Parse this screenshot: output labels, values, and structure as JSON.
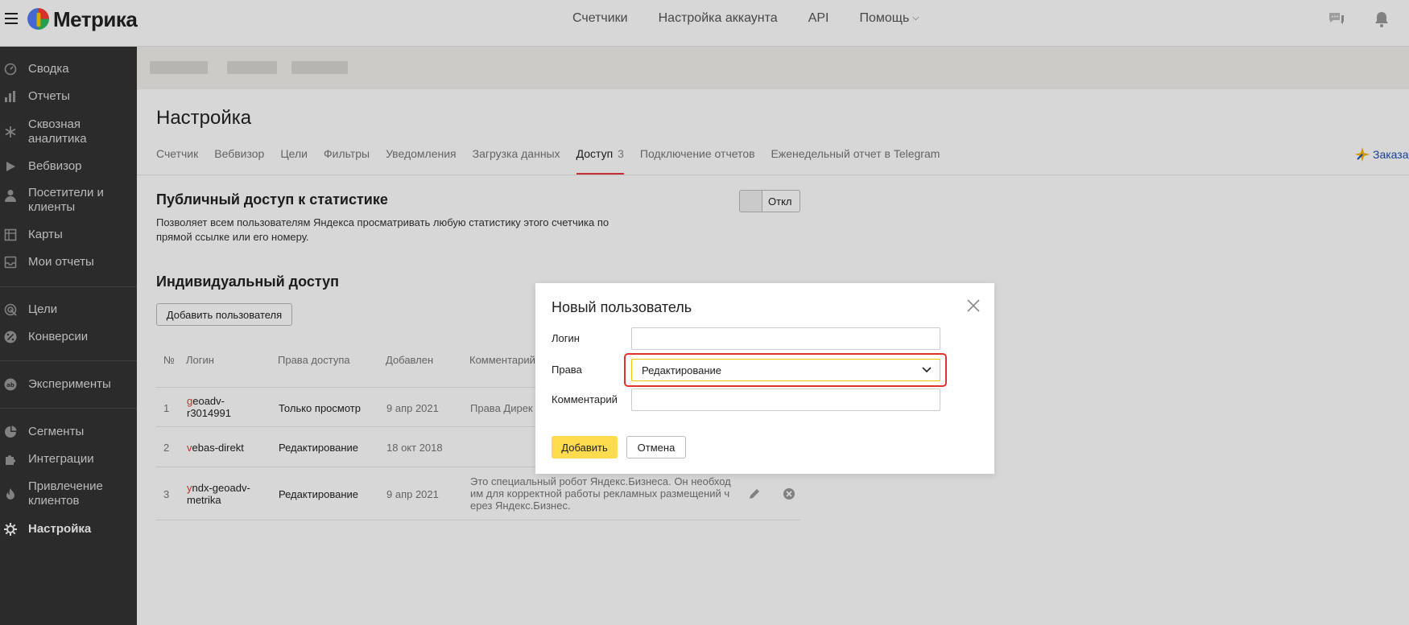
{
  "header": {
    "logo_text": "Метрика",
    "nav": [
      "Счетчики",
      "Настройка аккаунта",
      "API",
      "Помощь"
    ]
  },
  "sidebar": {
    "items": [
      {
        "label": "Сводка",
        "icon": "dashboard-icon"
      },
      {
        "label": "Отчеты",
        "icon": "bar-chart-icon"
      },
      {
        "label": "Сквозная аналитика",
        "icon": "snowflake-icon"
      },
      {
        "label": "Вебвизор",
        "icon": "play-icon"
      },
      {
        "label": "Посетители и клиенты",
        "icon": "person-icon"
      },
      {
        "label": "Карты",
        "icon": "map-icon"
      },
      {
        "label": "Мои отчеты",
        "icon": "inbox-icon"
      },
      {
        "label": "Цели",
        "icon": "target-icon"
      },
      {
        "label": "Конверсии",
        "icon": "percent-icon"
      },
      {
        "label": "Эксперименты",
        "icon": "ab-icon"
      },
      {
        "label": "Сегменты",
        "icon": "pie-icon"
      },
      {
        "label": "Интеграции",
        "icon": "puzzle-icon"
      },
      {
        "label": "Привлечение клиентов",
        "icon": "flame-icon"
      },
      {
        "label": "Настройка",
        "icon": "gear-icon",
        "active": true
      }
    ]
  },
  "page": {
    "title": "Настройка",
    "tabs": [
      "Счетчик",
      "Вебвизор",
      "Цели",
      "Фильтры",
      "Уведомления",
      "Загрузка данных",
      "Доступ",
      "Подключение отчетов",
      "Еженедельный отчет в Telegram"
    ],
    "active_tab": "Доступ",
    "access_count": "3",
    "order_link": "Заказа"
  },
  "public_access": {
    "title": "Публичный доступ к статистике",
    "description": "Позволяет всем пользователям Яндекса просматривать любую статистику этого счетчика по прямой ссылке или его номеру.",
    "toggle_label": "Откл"
  },
  "individual_access": {
    "title": "Индивидуальный доступ",
    "add_button": "Добавить пользователя",
    "columns": [
      "№",
      "Логин",
      "Права доступа",
      "Добавлен",
      "Комментарий"
    ],
    "rows": [
      {
        "num": "1",
        "login_first": "g",
        "login_rest_line1": "eoadv-",
        "login_line2": "r3014991",
        "rights": "Только просмотр",
        "added": "9 апр 2021",
        "comment": "Права Дирек"
      },
      {
        "num": "2",
        "login_first": "v",
        "login_rest_line1": "ebas-direkt",
        "login_line2": "",
        "rights": "Редактирование",
        "added": "18 окт 2018",
        "comment": ""
      },
      {
        "num": "3",
        "login_first": "y",
        "login_rest_line1": "ndx-geoadv-",
        "login_line2": "metrika",
        "rights": "Редактирование",
        "added": "9 апр 2021",
        "comment_lines": [
          "Это специальный робот Яндекс.Бизнеса. Он необход",
          "им для корректной работы рекламных размещений ч",
          "ерез Яндекс.Бизнес."
        ]
      }
    ]
  },
  "modal": {
    "title": "Новый пользователь",
    "login_label": "Логин",
    "login_value": "",
    "rights_label": "Права",
    "rights_value": "Редактирование",
    "comment_label": "Комментарий",
    "comment_value": "",
    "add_button": "Добавить",
    "cancel_button": "Отмена"
  },
  "colors": {
    "accent_red": "#e53a3a",
    "button_yellow": "#ffdb4d",
    "highlight_red": "#e0322b",
    "sidebar_bg": "#333333"
  }
}
